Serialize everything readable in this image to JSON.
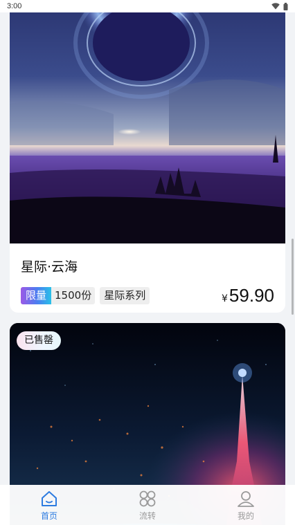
{
  "status_bar": {
    "time": "3:00",
    "icons": [
      "wifi-icon",
      "battery-icon"
    ]
  },
  "products": [
    {
      "title": "星际·云海",
      "limited_label": "限量",
      "quantity": "1500份",
      "series": "星际系列",
      "price_symbol": "¥",
      "price": "59.90",
      "sold_out": false
    },
    {
      "sold_out": true,
      "sold_label": "已售罄"
    }
  ],
  "nav": {
    "items": [
      {
        "label": "首页",
        "icon": "home-icon",
        "active": true
      },
      {
        "label": "流转",
        "icon": "grid-icon",
        "active": false
      },
      {
        "label": "我的",
        "icon": "user-icon",
        "active": false
      }
    ]
  },
  "colors": {
    "accent": "#2c7be0",
    "inactive": "#9a9a9a",
    "limited_gradient": [
      "#9b59e6",
      "#4a7ff0",
      "#29c0e8"
    ]
  }
}
